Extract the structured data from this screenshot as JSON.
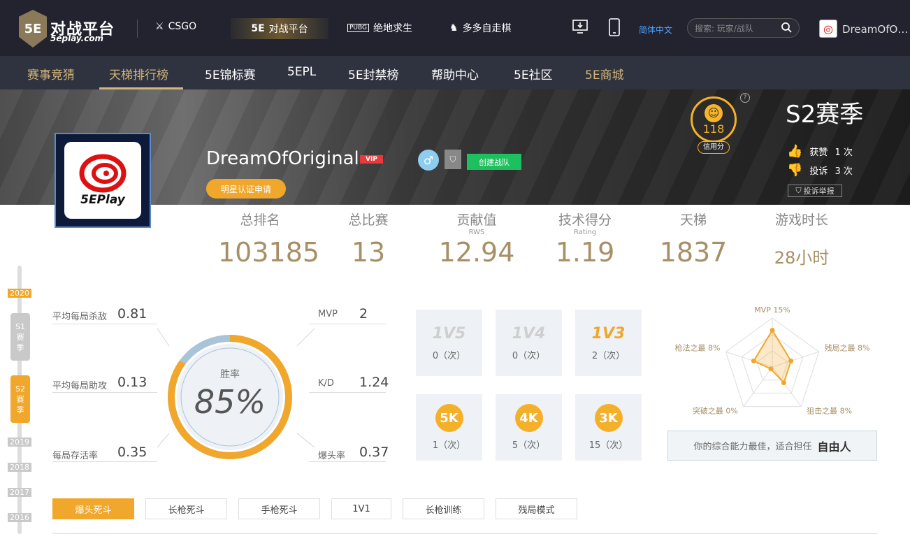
{
  "topbar": {
    "logo_mark": "5E",
    "logo_title": "对战平台",
    "logo_sub": "5eplay.com",
    "games": [
      {
        "label": "CSGO",
        "icon": "soldier-icon"
      },
      {
        "label": "对战平台",
        "icon": "5e-icon",
        "mark": "5E"
      },
      {
        "label": "绝地求生",
        "icon": "pubg-icon",
        "mark": "PUBG"
      },
      {
        "label": "多多自走棋",
        "icon": "chess-icon"
      }
    ],
    "language": "简体中文",
    "search_placeholder": "搜索: 玩家/战队",
    "username": "DreamOfOriginal"
  },
  "nav": {
    "items": [
      "赛事竞猜",
      "天梯排行榜",
      "5E锦标赛",
      "5EPL",
      "5E封禁榜",
      "帮助中心",
      "5E社区",
      "5E商城"
    ],
    "active_index": 1
  },
  "profile": {
    "avatar_text": "5EPlay",
    "username": "DreamOfOriginal",
    "vip": "VIP",
    "create_team": "创建战队",
    "star_apply": "明星认证申请",
    "credit_score": "118",
    "credit_label": "信用分",
    "help": "?",
    "season": "S2赛季",
    "likes_label": "获赞",
    "likes_count": "1 次",
    "dislikes_label": "投诉",
    "dislikes_count": "3 次",
    "report": "投诉举报"
  },
  "stats": [
    {
      "label": "总排名",
      "sub": "",
      "value": "103185"
    },
    {
      "label": "总比赛",
      "sub": "",
      "value": "13"
    },
    {
      "label": "贡献值",
      "sub": "RWS",
      "value": "12.94"
    },
    {
      "label": "技术得分",
      "sub": "Rating",
      "value": "1.19"
    },
    {
      "label": "天梯",
      "sub": "",
      "value": "1837"
    },
    {
      "label": "游戏时长",
      "sub": "",
      "value": "28小时"
    }
  ],
  "timeline": {
    "year_2020": "2020",
    "s1": [
      "S1",
      "赛",
      "季"
    ],
    "s2": [
      "S2",
      "赛",
      "季"
    ],
    "years": [
      "2019",
      "2018",
      "2017",
      "2016"
    ]
  },
  "performance": {
    "kills_label": "平均每局杀敌",
    "kills": "0.81",
    "assists_label": "平均每局助攻",
    "assists": "0.13",
    "survive_label": "每局存活率",
    "survive": "0.35",
    "mvp_label": "MVP",
    "mvp": "2",
    "kd_label": "K/D",
    "kd": "1.24",
    "hs_label": "爆头率",
    "hs": "0.37",
    "winrate_label": "胜率",
    "winrate": "85%",
    "winrate_value": 0.85
  },
  "achievements": [
    {
      "badge": "1V5",
      "count": "0（次）",
      "achieved": false
    },
    {
      "badge": "1V4",
      "count": "0（次）",
      "achieved": false
    },
    {
      "badge": "1V3",
      "count": "2（次）",
      "achieved": true
    },
    {
      "badge": "5K",
      "count": "1（次）",
      "achieved": true
    },
    {
      "badge": "4K",
      "count": "5（次）",
      "achieved": true
    },
    {
      "badge": "3K",
      "count": "15（次）",
      "achieved": true
    }
  ],
  "radar": {
    "labels": [
      "MVP 15%",
      "残局之最 8%",
      "狙击之最 8%",
      "突破之最 0%",
      "枪法之最 8%"
    ],
    "values": [
      15,
      8,
      8,
      0,
      8
    ],
    "max": 20
  },
  "ability": {
    "text": "你的综合能力最佳，适合担任",
    "role": "自由人"
  },
  "mode_tabs": [
    "爆头死斗",
    "长枪死斗",
    "手枪死斗",
    "1V1",
    "长枪训练",
    "残局模式"
  ],
  "colors": {
    "accent": "#f1a72b",
    "gold": "#a78f66",
    "green": "#1dbf5e"
  }
}
